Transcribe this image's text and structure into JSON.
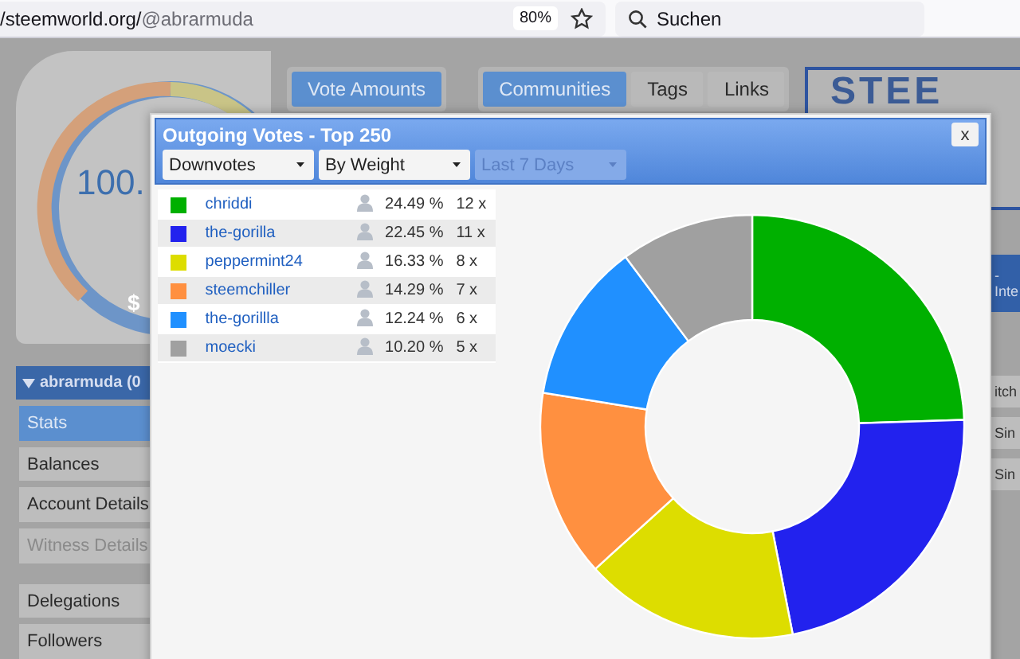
{
  "browser": {
    "url_host": "/steemworld.org/",
    "url_path": "@abrarmuda",
    "zoom": "80%",
    "search": {
      "placeholder": "Suchen"
    }
  },
  "gauge": {
    "value": "100.",
    "amount": "$"
  },
  "tab_groups": [
    [
      {
        "label": "Vote Amounts",
        "selected": true
      }
    ],
    [
      {
        "label": "Communities",
        "selected": true
      },
      {
        "label": "Tags",
        "selected": false
      },
      {
        "label": "Links",
        "selected": false
      }
    ]
  ],
  "banner": {
    "logo": "STEE",
    "band_mark": "-",
    "band_label": "Inte",
    "items": [
      "itch",
      "Sin",
      "Sin"
    ]
  },
  "sidebar": {
    "account": "abrarmuda (0",
    "items": [
      {
        "label": "Stats",
        "selected": true,
        "disabled": false
      },
      {
        "label": "Balances",
        "selected": false,
        "disabled": false
      },
      {
        "label": "Account Details",
        "selected": false,
        "disabled": false
      },
      {
        "label": "Witness Details",
        "selected": false,
        "disabled": true
      },
      {
        "label": "Delegations",
        "selected": false,
        "disabled": false
      },
      {
        "label": "Followers",
        "selected": false,
        "disabled": false
      }
    ]
  },
  "modal": {
    "title": "Outgoing Votes - Top 250",
    "close": "x",
    "filters": [
      {
        "value": "Downvotes",
        "disabled": false
      },
      {
        "value": "By Weight",
        "disabled": false
      },
      {
        "value": "Last 7 Days",
        "disabled": true
      }
    ],
    "rows": [
      {
        "color": "#00b000",
        "name": "chriddi",
        "percent": "24.49 %",
        "count": "12 x"
      },
      {
        "color": "#2222ee",
        "name": "the-gorilla",
        "percent": "22.45 %",
        "count": "11 x"
      },
      {
        "color": "#dddd00",
        "name": "peppermint24",
        "percent": "16.33 %",
        "count": "8 x"
      },
      {
        "color": "#ff9040",
        "name": "steemchiller",
        "percent": "14.29 %",
        "count": "7 x"
      },
      {
        "color": "#2090ff",
        "name": "the-gorillla",
        "percent": "12.24 %",
        "count": "6 x"
      },
      {
        "color": "#a0a0a0",
        "name": "moecki",
        "percent": "10.20 %",
        "count": "5 x"
      }
    ],
    "chart_data": {
      "type": "donut",
      "values": [
        24.49,
        22.45,
        16.33,
        14.29,
        12.24,
        10.2
      ]
    }
  }
}
